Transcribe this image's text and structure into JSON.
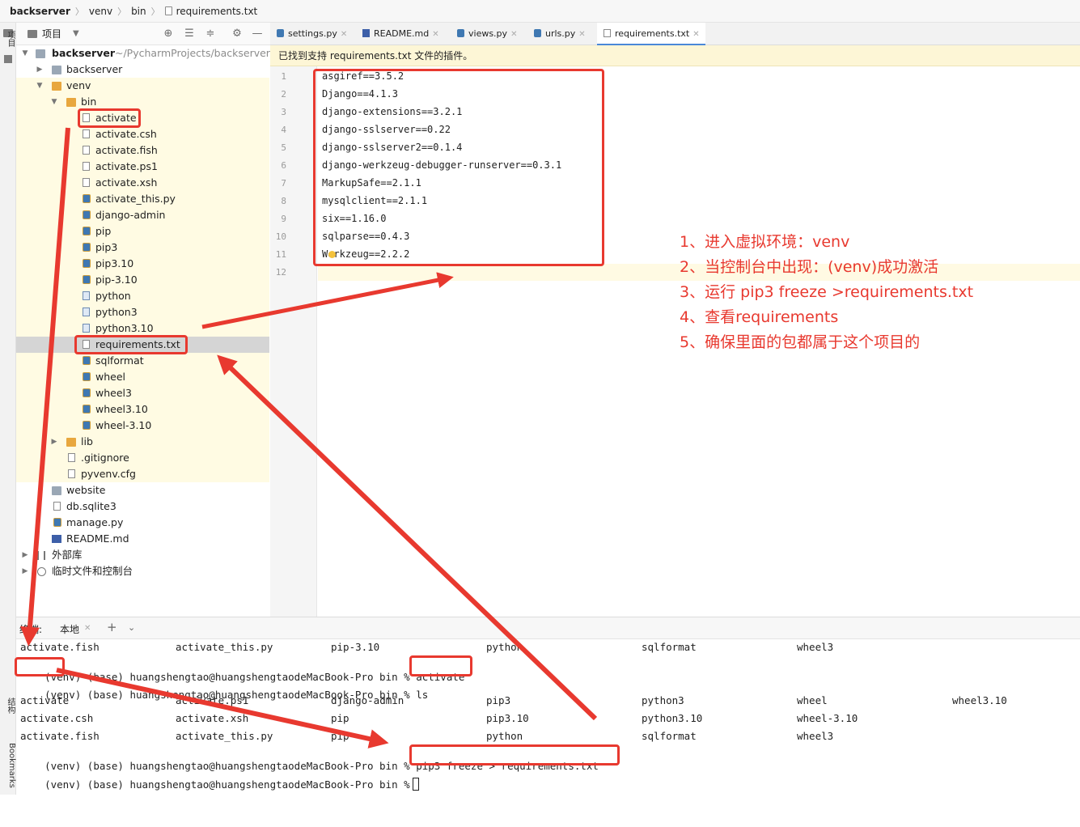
{
  "breadcrumb": {
    "items": [
      "backserver",
      "venv",
      "bin",
      "requirements.txt"
    ]
  },
  "side_strip": {
    "project": "项目",
    "structure": "结构",
    "bookmarks": "Bookmarks"
  },
  "project_panel": {
    "title": "项目",
    "root_label": "backserver",
    "root_path": "~/PycharmProjects/backserver",
    "tree": [
      {
        "label": "backserver"
      },
      {
        "label": "venv"
      },
      {
        "label": "bin"
      },
      {
        "label": "activate"
      },
      {
        "label": "activate.csh"
      },
      {
        "label": "activate.fish"
      },
      {
        "label": "activate.ps1"
      },
      {
        "label": "activate.xsh"
      },
      {
        "label": "activate_this.py"
      },
      {
        "label": "django-admin"
      },
      {
        "label": "pip"
      },
      {
        "label": "pip3"
      },
      {
        "label": "pip3.10"
      },
      {
        "label": "pip-3.10"
      },
      {
        "label": "python"
      },
      {
        "label": "python3"
      },
      {
        "label": "python3.10"
      },
      {
        "label": "requirements.txt"
      },
      {
        "label": "sqlformat"
      },
      {
        "label": "wheel"
      },
      {
        "label": "wheel3"
      },
      {
        "label": "wheel3.10"
      },
      {
        "label": "wheel-3.10"
      },
      {
        "label": "lib"
      },
      {
        "label": ".gitignore"
      },
      {
        "label": "pyvenv.cfg"
      },
      {
        "label": "website"
      },
      {
        "label": "db.sqlite3"
      },
      {
        "label": "manage.py"
      },
      {
        "label": "README.md"
      },
      {
        "label": "外部库"
      },
      {
        "label": "临时文件和控制台"
      }
    ]
  },
  "tabs": [
    {
      "label": "settings.py",
      "active": false
    },
    {
      "label": "README.md",
      "active": false
    },
    {
      "label": "views.py",
      "active": false
    },
    {
      "label": "urls.py",
      "active": false
    },
    {
      "label": "requirements.txt",
      "active": true
    }
  ],
  "plugin_notice": "已找到支持 requirements.txt 文件的插件。",
  "editor": {
    "line_numbers": [
      "1",
      "2",
      "3",
      "4",
      "5",
      "6",
      "7",
      "8",
      "9",
      "10",
      "11",
      "12"
    ],
    "lines": [
      "asgiref==3.5.2",
      "Django==4.1.3",
      "django-extensions==3.2.1",
      "django-sslserver==0.22",
      "django-sslserver2==0.1.4",
      "django-werkzeug-debugger-runserver==0.3.1",
      "MarkupSafe==2.1.1",
      "mysqlclient==2.1.1",
      "six==1.16.0",
      "sqlparse==0.4.3",
      "Werkzeug==2.2.2",
      ""
    ]
  },
  "annotations": [
    "1、进入虚拟环境：venv",
    "2、当控制台中出现：(venv)成功激活",
    "3、运行 pip3 freeze >requirements.txt",
    "4、查看requirements",
    "5、确保里面的包都属于这个项目的"
  ],
  "terminal": {
    "header_label": "终端:",
    "tab_label": "本地",
    "rows": [
      [
        "activate.fish",
        "activate_this.py",
        "pip-3.10",
        "python",
        "sqlformat",
        "wheel3",
        ""
      ],
      [
        "activate",
        "activate.ps1",
        "django-admin",
        "pip3",
        "python3",
        "wheel",
        "wheel3.10"
      ],
      [
        "activate.csh",
        "activate.xsh",
        "pip",
        "pip3.10",
        "python3.10",
        "wheel-3.10",
        ""
      ],
      [
        "activate.fish",
        "activate_this.py",
        "pip",
        "python",
        "sqlformat",
        "wheel3",
        ""
      ]
    ],
    "venv_prefix": "(venv)",
    "prompt_base": "(base) huangshengtao@huangshengtaodeMacBook-Pro bin %",
    "cmd_activate": "activate",
    "cmd_ls": "ls",
    "cmd_freeze": "pip3 freeze > requirements.txt"
  },
  "colors": {
    "annotation_red": "#e8392f",
    "venv_highlight": "#fffbe3",
    "notice_bg": "#fdf6d6",
    "active_tab_underline": "#4a88d8"
  }
}
